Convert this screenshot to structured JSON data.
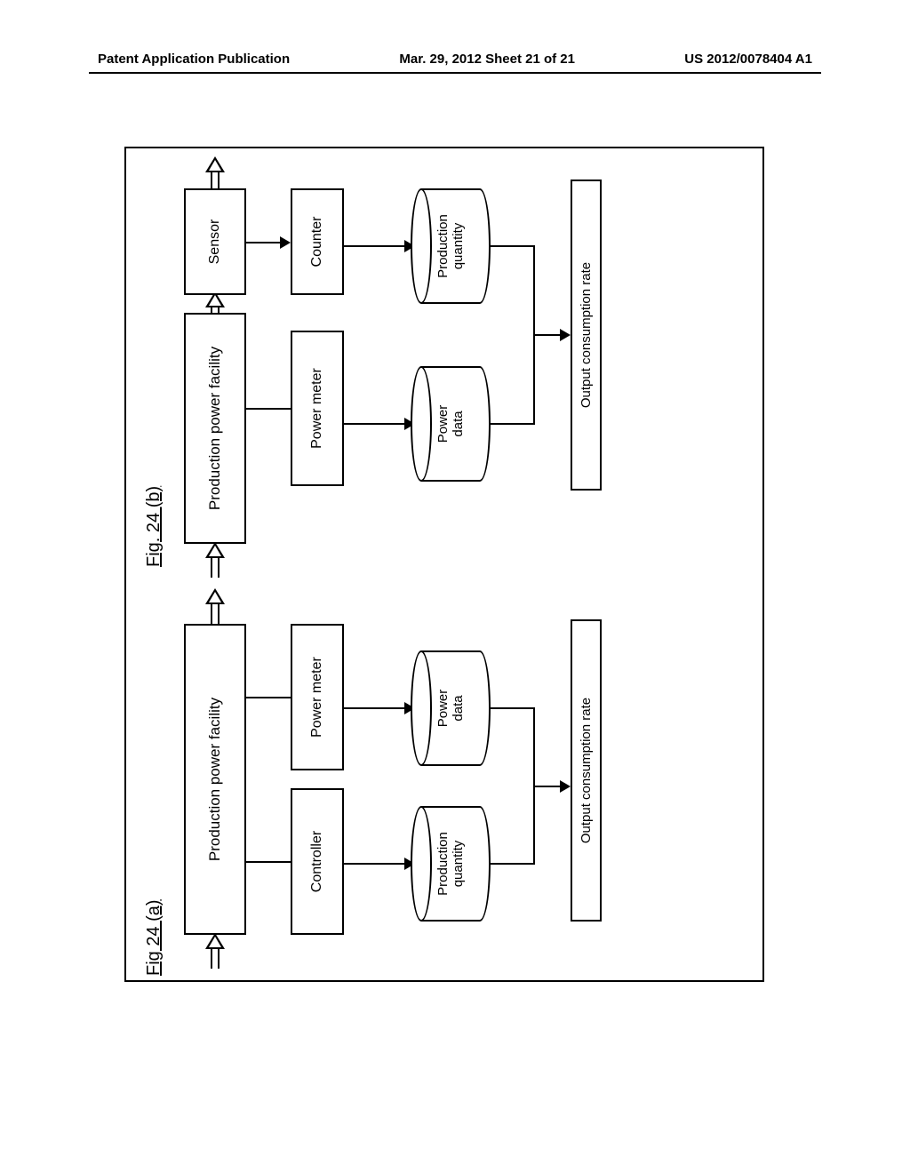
{
  "header": {
    "left": "Patent Application Publication",
    "center": "Mar. 29, 2012  Sheet 21 of 21",
    "right": "US 2012/0078404 A1"
  },
  "fig_a": {
    "label": "Fig 24 (a)",
    "facility": "Production power facility",
    "controller": "Controller",
    "meter": "Power meter",
    "db_pq": "Production\nquantity",
    "db_pd": "Power\ndata",
    "output": "Output consumption rate"
  },
  "fig_b": {
    "label": "Fig. 24 (b)",
    "facility": "Production power facility",
    "sensor": "Sensor",
    "meter": "Power meter",
    "counter": "Counter",
    "db_pd": "Power\ndata",
    "db_pq": "Production\nquantity",
    "output": "Output consumption rate"
  }
}
